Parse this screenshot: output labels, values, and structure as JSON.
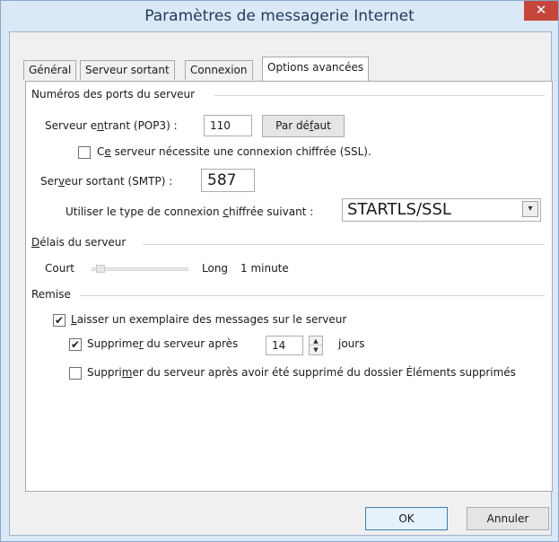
{
  "window": {
    "title": "Paramètres de messagerie Internet",
    "close_label": "✕"
  },
  "tabs": [
    {
      "label": "Général"
    },
    {
      "label": "Serveur sortant"
    },
    {
      "label": "Connexion"
    },
    {
      "label": "Options avancées",
      "active": true
    }
  ],
  "ports": {
    "group_label": "Numéros des ports du serveur",
    "incoming_label_pre": "Serveur e",
    "incoming_label_ul": "n",
    "incoming_label_post": "trant (POP3) :",
    "incoming_value": "110",
    "default_button_pre": "Par dé",
    "default_button_ul": "f",
    "default_button_post": "aut",
    "ssl_label_pre": "C",
    "ssl_label_ul": "e",
    "ssl_label_post": " serveur nécessite une connexion chiffrée (SSL).",
    "ssl_checked": false,
    "outgoing_label_pre": "Ser",
    "outgoing_label_ul": "v",
    "outgoing_label_post": "eur sortant (SMTP) :",
    "outgoing_value": "587",
    "encryption_label_pre": "Utiliser le type de connexion ",
    "encryption_label_ul": "c",
    "encryption_label_post": "hiffrée suivant :",
    "encryption_value": "STARTLS/SSL",
    "dropdown_arrow": "▾"
  },
  "timeout": {
    "group_label_ul": "D",
    "group_label_post": "élais du serveur",
    "short_label": "Court",
    "long_label": "Long",
    "value_text": "1 minute",
    "slider_fraction": 0.05
  },
  "delivery": {
    "group_label": "Remise",
    "keep_copy_label_ul": "L",
    "keep_copy_label_post": "aisser un exemplaire des messages sur le serveur",
    "keep_copy_checked": true,
    "remove_after_label_pre": "Supprime",
    "remove_after_label_ul": "r",
    "remove_after_label_post": " du serveur après",
    "remove_after_checked": true,
    "days_value": "14",
    "days_unit": "jours",
    "remove_deleted_label_pre": "Suppri",
    "remove_deleted_label_ul": "m",
    "remove_deleted_label_post": "er du serveur après avoir été supprimé du dossier Éléments supprimés",
    "remove_deleted_checked": false
  },
  "buttons": {
    "ok": "OK",
    "cancel": "Annuler"
  }
}
